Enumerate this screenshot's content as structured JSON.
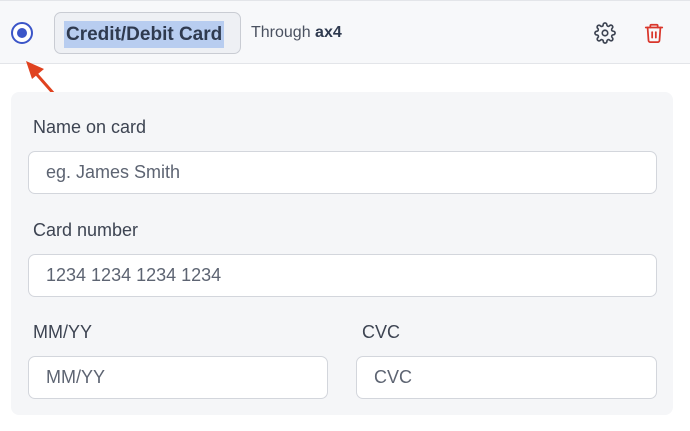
{
  "payment_method": {
    "label": "Credit/Debit Card",
    "through_prefix": "Through",
    "provider": "ax4",
    "selected": true,
    "accent_color": "#3b55c8",
    "delete_color": "#d9362b",
    "icons": {
      "settings": "gear-icon",
      "delete": "trash-icon"
    }
  },
  "form": {
    "name": {
      "label": "Name on card",
      "placeholder": "eg. James Smith",
      "value": ""
    },
    "card_number": {
      "label": "Card number",
      "placeholder": "1234 1234 1234 1234",
      "value": ""
    },
    "expiry": {
      "label": "MM/YY",
      "placeholder": "MM/YY",
      "value": ""
    },
    "cvc": {
      "label": "CVC",
      "placeholder": "CVC",
      "value": ""
    }
  }
}
